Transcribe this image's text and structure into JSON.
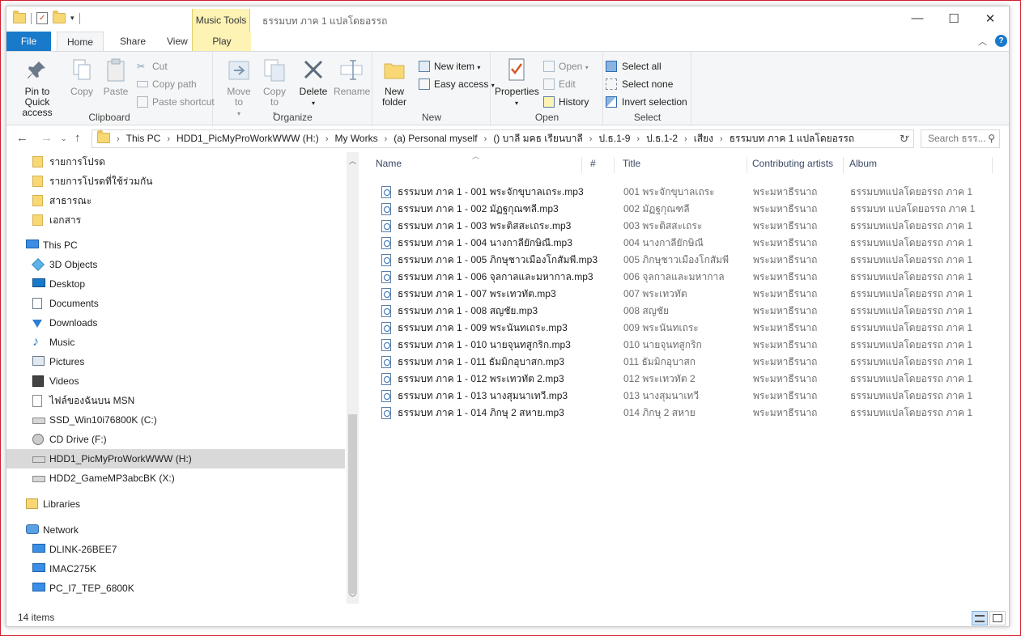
{
  "window": {
    "title": "ธรรมบท ภาค 1 แปลโดยอรรถ",
    "context_tab": "Music Tools"
  },
  "ribbon": {
    "tabs": [
      "File",
      "Home",
      "Share",
      "View",
      "Play"
    ],
    "clipboard": {
      "title": "Clipboard",
      "pin": "Pin to Quick access",
      "copy": "Copy",
      "paste": "Paste",
      "cut": "Cut",
      "copy_path": "Copy path",
      "paste_shortcut": "Paste shortcut"
    },
    "organize": {
      "title": "Organize",
      "move_to": "Move to",
      "copy_to": "Copy to",
      "delete": "Delete",
      "rename": "Rename"
    },
    "new": {
      "title": "New",
      "new_folder": "New folder",
      "new_item": "New item",
      "easy_access": "Easy access"
    },
    "open": {
      "title": "Open",
      "properties": "Properties",
      "open": "Open",
      "edit": "Edit",
      "history": "History"
    },
    "select": {
      "title": "Select",
      "select_all": "Select all",
      "select_none": "Select none",
      "invert": "Invert selection"
    }
  },
  "address": {
    "crumbs": [
      "This PC",
      "HDD1_PicMyProWorkWWW (H:)",
      "My Works",
      "(a) Personal myself",
      "() บาลี มคธ เรียนบาลี",
      "ป.ธ.1-9",
      "ป.ธ.1-2",
      "เสียง",
      "ธรรมบท ภาค 1 แปลโดยอรรถ"
    ],
    "search_placeholder": "Search ธรร..."
  },
  "nav": [
    {
      "label": "รายการโปรด",
      "icon": "folder-icon",
      "level": 2
    },
    {
      "label": "รายการโปรดที่ใช้ร่วมกัน",
      "icon": "folder-icon",
      "level": 2
    },
    {
      "label": "สาธารณะ",
      "icon": "folder-icon",
      "level": 2
    },
    {
      "label": "เอกสาร",
      "icon": "folder-icon",
      "level": 2
    },
    {
      "label": "This PC",
      "icon": "computer-icon",
      "level": 1
    },
    {
      "label": "3D Objects",
      "icon": "cube-icon",
      "level": 2
    },
    {
      "label": "Desktop",
      "icon": "desktop-icon",
      "level": 2
    },
    {
      "label": "Documents",
      "icon": "documents-icon",
      "level": 2
    },
    {
      "label": "Downloads",
      "icon": "download-icon",
      "level": 2
    },
    {
      "label": "Music",
      "icon": "music-icon",
      "level": 2
    },
    {
      "label": "Pictures",
      "icon": "pictures-icon",
      "level": 2
    },
    {
      "label": "Videos",
      "icon": "videos-icon",
      "level": 2
    },
    {
      "label": "ไฟล์ของฉันบน MSN",
      "icon": "file-icon",
      "level": 2
    },
    {
      "label": "SSD_Win10i76800K (C:)",
      "icon": "drive-icon",
      "level": 2
    },
    {
      "label": "CD Drive (F:)",
      "icon": "cd-icon",
      "level": 2
    },
    {
      "label": "HDD1_PicMyProWorkWWW (H:)",
      "icon": "drive-icon",
      "level": 2,
      "selected": true
    },
    {
      "label": "HDD2_GameMP3abcBK (X:)",
      "icon": "drive-icon",
      "level": 2
    },
    {
      "label": "Libraries",
      "icon": "libraries-icon",
      "level": 1
    },
    {
      "label": "Network",
      "icon": "network-icon",
      "level": 1
    },
    {
      "label": "DLINK-26BEE7",
      "icon": "computer-icon",
      "level": 2
    },
    {
      "label": "IMAC275K",
      "icon": "computer-icon",
      "level": 2
    },
    {
      "label": "PC_I7_TEP_6800K",
      "icon": "computer-icon",
      "level": 2
    }
  ],
  "columns": [
    "Name",
    "#",
    "Title",
    "Contributing artists",
    "Album"
  ],
  "files": [
    {
      "name": "ธรรมบท ภาค 1 - 001 พระจักขุบาลเถระ.mp3",
      "title": "001 พระจักขุบาลเถระ",
      "artist": "พระมหาธีรนาถ",
      "album": "ธรรมบทแปลโดยอรรถ ภาค 1"
    },
    {
      "name": "ธรรมบท ภาค 1 - 002 มัฏฐกุณฑลี.mp3",
      "title": "002 มัฏฐกุณฑลี",
      "artist": "พระมหาธีรนาถ",
      "album": "ธรรมบท แปลโดยอรรถ ภาค 1"
    },
    {
      "name": "ธรรมบท ภาค 1 - 003 พระติสสะเถระ.mp3",
      "title": "003 พระติสสะเถระ",
      "artist": "พระมหาธีรนาถ",
      "album": "ธรรมบทแปลโดยอรรถ ภาค 1"
    },
    {
      "name": "ธรรมบท ภาค 1 - 004 นางกาลียักษิณี.mp3",
      "title": "004 นางกาลียักษิณี",
      "artist": "พระมหาธีรนาถ",
      "album": "ธรรมบทแปลโดยอรรถ ภาค 1"
    },
    {
      "name": "ธรรมบท ภาค 1 - 005 ภิกษุชาวเมืองโกสัมพี.mp3",
      "title": "005 ภิกษุชาวเมืองโกสัมพี",
      "artist": "พระมหาธีรนาถ",
      "album": "ธรรมบทแปลโดยอรรถ ภาค 1"
    },
    {
      "name": "ธรรมบท ภาค 1 - 006 จุลกาลและมหากาล.mp3",
      "title": "006 จุลกาลและมหากาล",
      "artist": "พระมหาธีรนาถ",
      "album": "ธรรมบทแปลโดยอรรถ ภาค 1"
    },
    {
      "name": "ธรรมบท ภาค 1 - 007 พระเทวทัต.mp3",
      "title": "007 พระเทวทัต",
      "artist": "พระมหาธีรนาถ",
      "album": "ธรรมบทแปลโดยอรรถ ภาค 1"
    },
    {
      "name": "ธรรมบท ภาค 1 - 008 สญชัย.mp3",
      "title": "008 สญชัย",
      "artist": "พระมหาธีรนาถ",
      "album": "ธรรมบทแปลโดยอรรถ ภาค 1"
    },
    {
      "name": "ธรรมบท ภาค 1 - 009 พระนันทเถระ.mp3",
      "title": "009 พระนันทเถระ",
      "artist": "พระมหาธีรนาถ",
      "album": "ธรรมบทแปลโดยอรรถ ภาค 1"
    },
    {
      "name": "ธรรมบท ภาค 1 - 010 นายจุนทสูกริก.mp3",
      "title": "010 นายจุนทสูกริก",
      "artist": "พระมหาธีรนาถ",
      "album": "ธรรมบทแปลโดยอรรถ ภาค 1"
    },
    {
      "name": "ธรรมบท ภาค 1 - 011 ธัมมิกอุบาสก.mp3",
      "title": "011 ธัมมิกอุบาสก",
      "artist": "พระมหาธีรนาถ",
      "album": "ธรรมบทแปลโดยอรรถ ภาค 1"
    },
    {
      "name": "ธรรมบท ภาค 1 - 012 พระเทวทัต 2.mp3",
      "title": "012 พระเทวทัต 2",
      "artist": "พระมหาธีรนาถ",
      "album": "ธรรมบทแปลโดยอรรถ ภาค 1"
    },
    {
      "name": "ธรรมบท ภาค 1 - 013 นางสุมนาเทวี.mp3",
      "title": "013 นางสุมนาเทวี",
      "artist": "พระมหาธีรนาถ",
      "album": "ธรรมบทแปลโดยอรรถ ภาค 1"
    },
    {
      "name": "ธรรมบท ภาค 1 - 014 ภิกษุ 2 สหาย.mp3",
      "title": "014 ภิกษุ 2 สหาย",
      "artist": "พระมหาธีรนาถ",
      "album": "ธรรมบทแปลโดยอรรถ ภาค 1"
    }
  ],
  "status": {
    "count": "14 items"
  },
  "colors": {
    "file_tab": "#1979ca",
    "context_tab": "#fdf3b5",
    "selected_nav": "#d9d9d9",
    "window_border": "#d01f2f"
  }
}
